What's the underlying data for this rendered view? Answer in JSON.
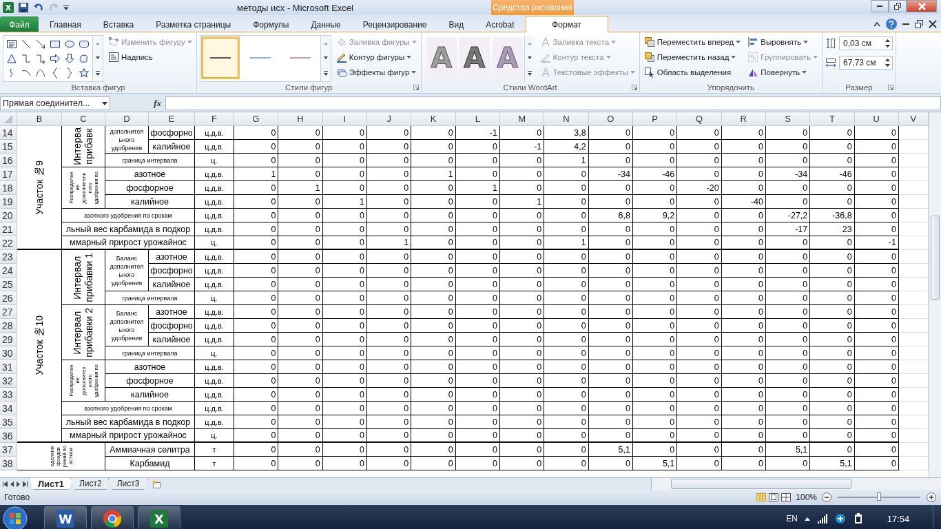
{
  "title_bar": {
    "app_icon_letter": "X",
    "title": "методы исх  -  Microsoft Excel",
    "context_tab": "Средства рисования"
  },
  "tabs": [
    {
      "label": "Файл",
      "kind": "file",
      "selected": false
    },
    {
      "label": "Главная",
      "kind": "normal",
      "selected": false
    },
    {
      "label": "Вставка",
      "kind": "normal",
      "selected": false
    },
    {
      "label": "Разметка страницы",
      "kind": "normal",
      "selected": false
    },
    {
      "label": "Формулы",
      "kind": "normal",
      "selected": false
    },
    {
      "label": "Данные",
      "kind": "normal",
      "selected": false
    },
    {
      "label": "Рецензирование",
      "kind": "normal",
      "selected": false
    },
    {
      "label": "Вид",
      "kind": "normal",
      "selected": false
    },
    {
      "label": "Acrobat",
      "kind": "normal",
      "selected": false
    },
    {
      "label": "Формат",
      "kind": "context",
      "selected": true
    }
  ],
  "ribbon": {
    "groups": [
      {
        "kind": "shapes",
        "title": "Вставка фигур",
        "launcher": false,
        "buttons": [
          {
            "label": "Изменить фигуру",
            "disabled": true,
            "dropdown": true
          },
          {
            "label": "Надпись",
            "disabled": false,
            "dropdown": false
          }
        ]
      },
      {
        "kind": "shape-styles",
        "title": "Стили фигур",
        "launcher": true,
        "styles": [
          {
            "color": "#595959",
            "selected": true
          },
          {
            "color": "#8eb4e3",
            "selected": false
          },
          {
            "color": "#e6999a",
            "selected": false
          }
        ],
        "buttons": [
          {
            "label": "Заливка фигуры",
            "disabled": true,
            "dropdown": true
          },
          {
            "label": "Контур фигуры",
            "disabled": false,
            "dropdown": true
          },
          {
            "label": "Эффекты фигур",
            "disabled": false,
            "dropdown": true
          }
        ]
      },
      {
        "kind": "wordart",
        "title": "Стили WordArt",
        "launcher": true,
        "samples": [
          "A",
          "A",
          "A"
        ],
        "buttons": [
          {
            "label": "Заливка текста",
            "disabled": true,
            "dropdown": true
          },
          {
            "label": "Контур текста",
            "disabled": true,
            "dropdown": true
          },
          {
            "label": "Текстовые эффекты",
            "disabled": true,
            "dropdown": true
          }
        ]
      },
      {
        "kind": "arrange",
        "title": "Упорядочить",
        "launcher": false,
        "buttons": [
          {
            "label": "Переместить вперед",
            "disabled": false,
            "dropdown": true
          },
          {
            "label": "Переместить назад",
            "disabled": false,
            "dropdown": true
          },
          {
            "label": "Область выделения",
            "disabled": false,
            "dropdown": false
          },
          {
            "label": "Выровнять",
            "disabled": false,
            "dropdown": true
          },
          {
            "label": "Группировать",
            "disabled": true,
            "dropdown": true
          },
          {
            "label": "Повернуть",
            "disabled": false,
            "dropdown": true
          }
        ]
      },
      {
        "kind": "size",
        "title": "Размер",
        "launcher": true,
        "fields": [
          "0,03 см",
          "67,73 см"
        ]
      }
    ]
  },
  "formula_bar": {
    "name_box": "Прямая соединител...",
    "fx": "fx"
  },
  "sheet": {
    "columns": [
      "B",
      "C",
      "D",
      "E",
      "F",
      "G",
      "H",
      "I",
      "J",
      "K",
      "L",
      "M",
      "N",
      "O",
      "P",
      "Q",
      "R",
      "S",
      "T",
      "U",
      "V"
    ],
    "sections": [
      {
        "label": "Участок №9",
        "kind": "rotated",
        "heavy_rule": true,
        "double_rule": false,
        "children": [
          {
            "label": "Интерва\nприбавк",
            "kind": "rotated",
            "children": [
              {
                "label": "дополнител\nьного\nудобрения",
                "kind": "small",
                "children": [
                  {
                    "number": "14",
                    "label": "фосфорно",
                    "kind": "plain",
                    "unit": "ц.д.в.",
                    "values": [
                      "0",
                      "0",
                      "0",
                      "0",
                      "0",
                      "-1",
                      "0",
                      "3,8",
                      "0",
                      "0",
                      "0",
                      "0",
                      "0",
                      "0",
                      "0"
                    ]
                  },
                  {
                    "number": "15",
                    "label": "калийное",
                    "kind": "plain",
                    "unit": "ц.д.в.",
                    "values": [
                      "0",
                      "0",
                      "0",
                      "0",
                      "0",
                      "0",
                      "-1",
                      "4,2",
                      "0",
                      "0",
                      "0",
                      "0",
                      "0",
                      "0",
                      "0"
                    ]
                  }
                ]
              },
              {
                "number": "16",
                "label": "граница интервала",
                "kind": "small",
                "unit": "ц.",
                "values": [
                  "0",
                  "0",
                  "0",
                  "0",
                  "0",
                  "0",
                  "0",
                  "1",
                  "0",
                  "0",
                  "0",
                  "0",
                  "0",
                  "0",
                  "0"
                ]
              }
            ]
          },
          {
            "label": "Распределен\nие\nдополнитель\nного\nудобрения по",
            "kind": "rotated-small",
            "children": [
              {
                "number": "17",
                "label": "азотное",
                "kind": "plain",
                "unit": "ц.д.в.",
                "values": [
                  "1",
                  "0",
                  "0",
                  "0",
                  "1",
                  "0",
                  "0",
                  "0",
                  "-34",
                  "-46",
                  "0",
                  "0",
                  "-34",
                  "-46",
                  "0"
                ]
              },
              {
                "number": "18",
                "label": "фосфорное",
                "kind": "plain",
                "unit": "ц.д.в.",
                "values": [
                  "0",
                  "1",
                  "0",
                  "0",
                  "0",
                  "1",
                  "0",
                  "0",
                  "0",
                  "0",
                  "-20",
                  "0",
                  "0",
                  "0",
                  "0"
                ]
              },
              {
                "number": "19",
                "label": "калийное",
                "kind": "plain",
                "unit": "ц.д.в.",
                "values": [
                  "0",
                  "0",
                  "1",
                  "0",
                  "0",
                  "0",
                  "1",
                  "0",
                  "0",
                  "0",
                  "0",
                  "-40",
                  "0",
                  "0",
                  "0"
                ]
              }
            ]
          },
          {
            "number": "20",
            "label": "азотного удобрения по срокам",
            "kind": "small",
            "unit": "ц.д.в.",
            "values": [
              "0",
              "0",
              "0",
              "0",
              "0",
              "0",
              "0",
              "0",
              "6,8",
              "9,2",
              "0",
              "0",
              "-27,2",
              "-36,8",
              "0"
            ]
          },
          {
            "number": "21",
            "label": "льный вес карбамида в подкор",
            "kind": "plain",
            "unit": "ц.д.в.",
            "values": [
              "0",
              "0",
              "0",
              "0",
              "0",
              "0",
              "0",
              "0",
              "0",
              "0",
              "0",
              "0",
              "-17",
              "23",
              "0"
            ]
          },
          {
            "number": "22",
            "label": "ммарный прирост урожайнос",
            "kind": "plain",
            "unit": "ц.",
            "values": [
              "0",
              "0",
              "0",
              "1",
              "0",
              "0",
              "0",
              "1",
              "0",
              "0",
              "0",
              "0",
              "0",
              "0",
              "-1"
            ]
          }
        ]
      },
      {
        "label": "Участок №10",
        "kind": "rotated",
        "heavy_rule": false,
        "double_rule": true,
        "children": [
          {
            "label": "Интервал\nприбавки 1",
            "kind": "rotated",
            "children": [
              {
                "label": "Баланс\nдополнител\nьного\nудобрения",
                "kind": "small",
                "children": [
                  {
                    "number": "23",
                    "label": "азотное",
                    "kind": "plain",
                    "unit": "ц.д.в.",
                    "values": [
                      "0",
                      "0",
                      "0",
                      "0",
                      "0",
                      "0",
                      "0",
                      "0",
                      "0",
                      "0",
                      "0",
                      "0",
                      "0",
                      "0",
                      "0"
                    ]
                  },
                  {
                    "number": "24",
                    "label": "фосфорно",
                    "kind": "plain",
                    "unit": "ц.д.в.",
                    "values": [
                      "0",
                      "0",
                      "0",
                      "0",
                      "0",
                      "0",
                      "0",
                      "0",
                      "0",
                      "0",
                      "0",
                      "0",
                      "0",
                      "0",
                      "0"
                    ]
                  },
                  {
                    "number": "25",
                    "label": "калийное",
                    "kind": "plain",
                    "unit": "ц.д.в.",
                    "values": [
                      "0",
                      "0",
                      "0",
                      "0",
                      "0",
                      "0",
                      "0",
                      "0",
                      "0",
                      "0",
                      "0",
                      "0",
                      "0",
                      "0",
                      "0"
                    ]
                  }
                ]
              },
              {
                "number": "26",
                "label": "граница интервала",
                "kind": "small",
                "unit": "ц.",
                "values": [
                  "0",
                  "0",
                  "0",
                  "0",
                  "0",
                  "0",
                  "0",
                  "0",
                  "0",
                  "0",
                  "0",
                  "0",
                  "0",
                  "0",
                  "0"
                ]
              }
            ]
          },
          {
            "label": "Интервал\nприбавки 2",
            "kind": "rotated",
            "children": [
              {
                "label": "Баланс\nдополнител\nьного\nудобрения",
                "kind": "small",
                "children": [
                  {
                    "number": "27",
                    "label": "азотное",
                    "kind": "plain",
                    "unit": "ц.д.в.",
                    "values": [
                      "0",
                      "0",
                      "0",
                      "0",
                      "0",
                      "0",
                      "0",
                      "0",
                      "0",
                      "0",
                      "0",
                      "0",
                      "0",
                      "0",
                      "0"
                    ]
                  },
                  {
                    "number": "28",
                    "label": "фосфорно",
                    "kind": "plain",
                    "unit": "ц.д.в.",
                    "values": [
                      "0",
                      "0",
                      "0",
                      "0",
                      "0",
                      "0",
                      "0",
                      "0",
                      "0",
                      "0",
                      "0",
                      "0",
                      "0",
                      "0",
                      "0"
                    ]
                  },
                  {
                    "number": "29",
                    "label": "калийное",
                    "kind": "plain",
                    "unit": "ц.д.в.",
                    "values": [
                      "0",
                      "0",
                      "0",
                      "0",
                      "0",
                      "0",
                      "0",
                      "0",
                      "0",
                      "0",
                      "0",
                      "0",
                      "0",
                      "0",
                      "0"
                    ]
                  }
                ]
              },
              {
                "number": "30",
                "label": "граница интервала",
                "kind": "small",
                "unit": "ц.",
                "values": [
                  "0",
                  "0",
                  "0",
                  "0",
                  "0",
                  "0",
                  "0",
                  "0",
                  "0",
                  "0",
                  "0",
                  "0",
                  "0",
                  "0",
                  "0"
                ]
              }
            ]
          },
          {
            "label": "Распределен\nие\nдополнител\nьного\nудобрения по",
            "kind": "rotated-small",
            "children": [
              {
                "number": "31",
                "label": "азотное",
                "kind": "plain",
                "unit": "ц.д.в.",
                "values": [
                  "0",
                  "0",
                  "0",
                  "0",
                  "0",
                  "0",
                  "0",
                  "0",
                  "0",
                  "0",
                  "0",
                  "0",
                  "0",
                  "0",
                  "0"
                ]
              },
              {
                "number": "32",
                "label": "фосфорное",
                "kind": "plain",
                "unit": "ц.д.в.",
                "values": [
                  "0",
                  "0",
                  "0",
                  "0",
                  "0",
                  "0",
                  "0",
                  "0",
                  "0",
                  "0",
                  "0",
                  "0",
                  "0",
                  "0",
                  "0"
                ]
              },
              {
                "number": "33",
                "label": "калийное",
                "kind": "plain",
                "unit": "ц.д.в.",
                "values": [
                  "0",
                  "0",
                  "0",
                  "0",
                  "0",
                  "0",
                  "0",
                  "0",
                  "0",
                  "0",
                  "0",
                  "0",
                  "0",
                  "0",
                  "0"
                ]
              }
            ]
          },
          {
            "number": "34",
            "label": "азотного удобрения по срокам",
            "kind": "small",
            "unit": "ц.д.в.",
            "values": [
              "0",
              "0",
              "0",
              "0",
              "0",
              "0",
              "0",
              "0",
              "0",
              "0",
              "0",
              "0",
              "0",
              "0",
              "0"
            ]
          },
          {
            "number": "35",
            "label": "льный вес карбамида в подкор",
            "kind": "plain",
            "unit": "ц.д.в.",
            "values": [
              "0",
              "0",
              "0",
              "0",
              "0",
              "0",
              "0",
              "0",
              "0",
              "0",
              "0",
              "0",
              "0",
              "0",
              "0"
            ]
          },
          {
            "number": "36",
            "label": "ммарный прирост урожайнос",
            "kind": "plain",
            "unit": "ц.",
            "values": [
              "0",
              "0",
              "0",
              "0",
              "0",
              "0",
              "0",
              "0",
              "0",
              "0",
              "0",
              "0",
              "0",
              "0",
              "0"
            ]
          }
        ]
      },
      {
        "label": "еделени\nфондов\nрений по\nасткам",
        "kind": "rotated-small-wide",
        "heavy_rule": false,
        "double_rule": false,
        "children": [
          {
            "number": "37",
            "label": "Аммиачная селитра",
            "kind": "plain",
            "unit": "т",
            "values": [
              "0",
              "0",
              "0",
              "0",
              "0",
              "0",
              "0",
              "0",
              "5,1",
              "0",
              "0",
              "0",
              "5,1",
              "0",
              "0"
            ]
          },
          {
            "number": "38",
            "label": "Карбамид",
            "kind": "plain",
            "unit": "т",
            "values": [
              "0",
              "0",
              "0",
              "0",
              "0",
              "0",
              "0",
              "0",
              "0",
              "5,1",
              "0",
              "0",
              "0",
              "5,1",
              "0"
            ]
          }
        ]
      }
    ]
  },
  "sheet_tabs": [
    {
      "label": "Лист1",
      "selected": true
    },
    {
      "label": "Лист2",
      "selected": false
    },
    {
      "label": "Лист3",
      "selected": false
    }
  ],
  "status_bar": {
    "text": "Готово",
    "zoom": "100%",
    "zoom_slider": {
      "level": 0.5
    }
  },
  "taskbar": {
    "apps": [
      {
        "kind": "doc",
        "letter": "W"
      },
      {
        "kind": "browser"
      },
      {
        "kind": "sheet",
        "letter": "X"
      }
    ],
    "language": "EN",
    "clock": "17:54"
  }
}
